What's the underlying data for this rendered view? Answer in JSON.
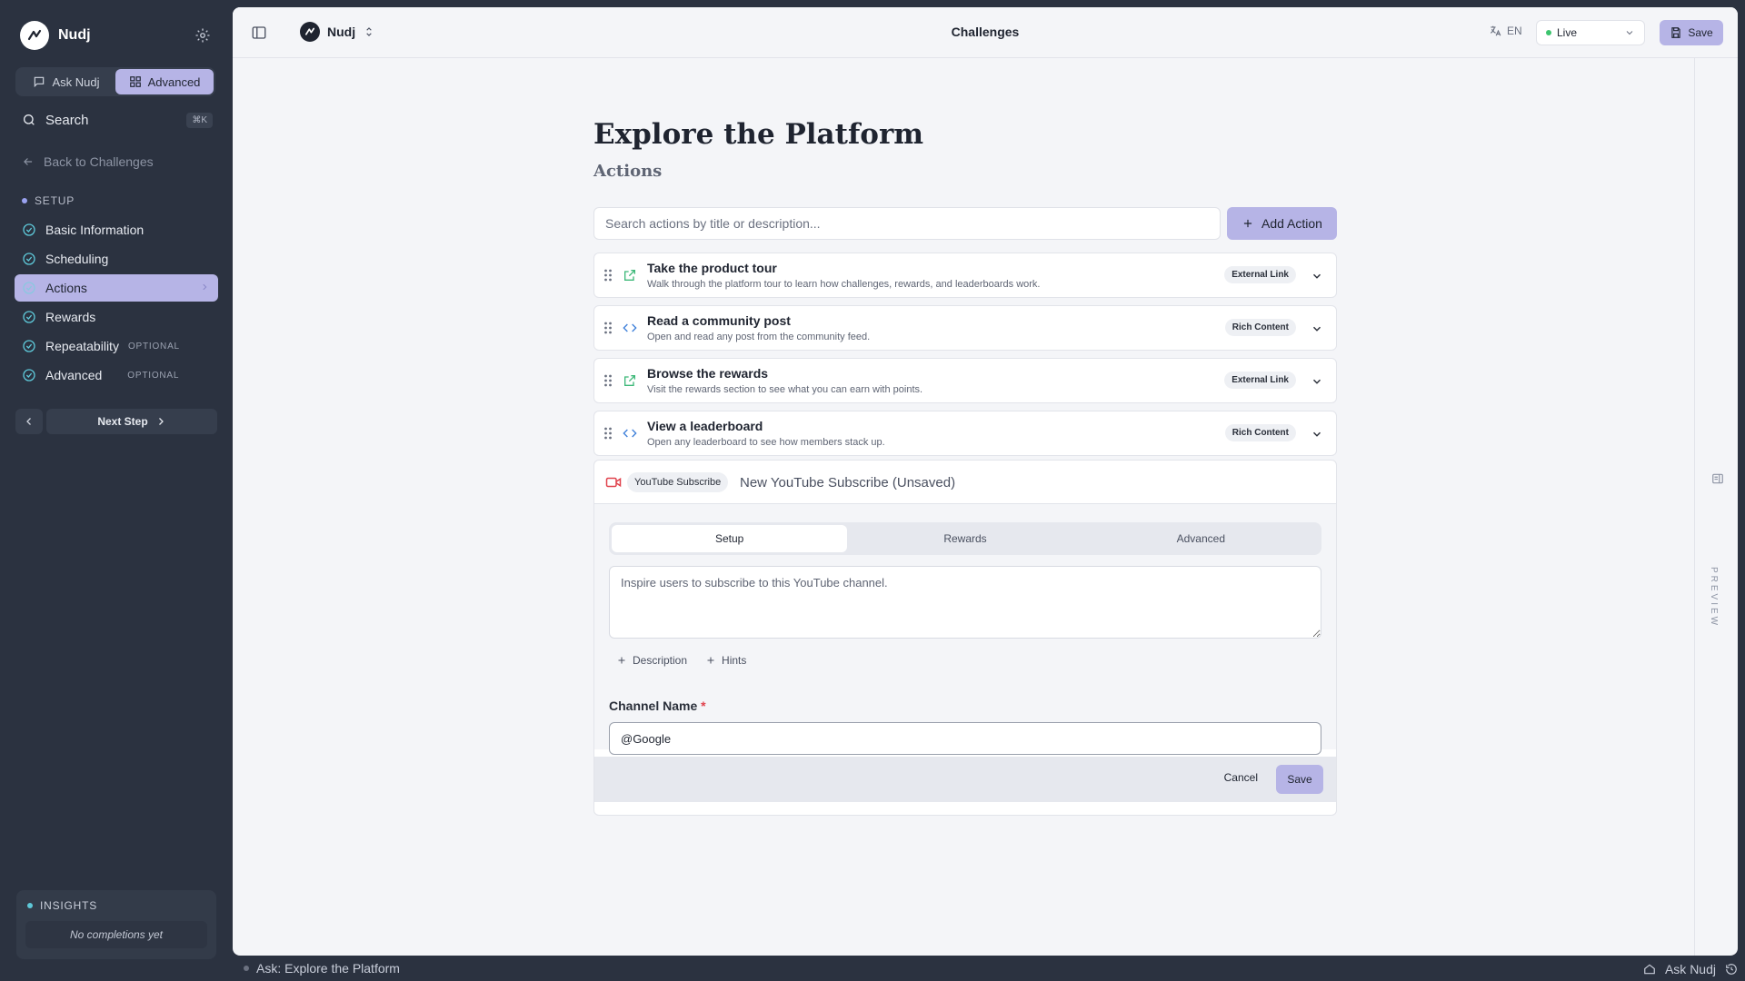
{
  "brand": {
    "name": "Nudj"
  },
  "sidebar": {
    "mode_ask": "Ask Nudj",
    "mode_advanced": "Advanced",
    "search_label": "Search",
    "search_shortcut": "⌘K",
    "back_label": "Back to Challenges",
    "section_label": "SETUP",
    "items": [
      {
        "label": "Basic Information",
        "badge": ""
      },
      {
        "label": "Scheduling",
        "badge": ""
      },
      {
        "label": "Actions",
        "badge": ""
      },
      {
        "label": "Rewards",
        "badge": ""
      },
      {
        "label": "Repeatability",
        "badge": "OPTIONAL"
      },
      {
        "label": "Advanced",
        "badge": "OPTIONAL"
      }
    ],
    "active_item": "Actions",
    "next_step_label": "Next Step",
    "insights_label": "INSIGHTS",
    "insights_empty": "No completions yet"
  },
  "topbar": {
    "org_name": "Nudj",
    "title": "Challenges",
    "language": "EN",
    "status": "Live",
    "save_label": "Save"
  },
  "page": {
    "title": "Explore the Platform",
    "subtitle": "Actions",
    "search_placeholder": "Search actions by title or description...",
    "add_action_label": "Add Action"
  },
  "actions": [
    {
      "title": "Take the product tour",
      "description": "Walk through the platform tour to learn how challenges, rewards, and leaderboards work.",
      "type": "External Link",
      "icon": "external-link-icon"
    },
    {
      "title": "Read a community post",
      "description": "Open and read any post from the community feed.",
      "type": "Rich Content",
      "icon": "code-icon"
    },
    {
      "title": "Browse the rewards",
      "description": "Visit the rewards section to see what you can earn with points.",
      "type": "External Link",
      "icon": "external-link-icon"
    },
    {
      "title": "View a leaderboard",
      "description": "Open any leaderboard to see how members stack up.",
      "type": "Rich Content",
      "icon": "code-icon"
    }
  ],
  "editor": {
    "type_badge": "YouTube Subscribe",
    "title_value": "New YouTube Subscribe (Unsaved)",
    "tabs": [
      "Setup",
      "Rewards",
      "Advanced"
    ],
    "active_tab": "Setup",
    "description_placeholder": "Inspire users to subscribe to this YouTube channel.",
    "add_description_label": "Description",
    "add_hints_label": "Hints",
    "channel_label": "Channel Name",
    "required_mark": "*",
    "channel_value": "@Google",
    "cancel_label": "Cancel",
    "save_label": "Save"
  },
  "preview_label": "PREVIEW",
  "bottom_bar": {
    "ask_context": "Ask: Explore the Platform",
    "ask_button": "Ask Nudj"
  },
  "colors": {
    "accent": "#b6b4e6",
    "sidebar_bg": "#2b3240",
    "panel_bg": "#f4f5f8",
    "link_green": "#3cb878",
    "code_blue": "#3d7fd9",
    "youtube_red": "#e0424c"
  }
}
